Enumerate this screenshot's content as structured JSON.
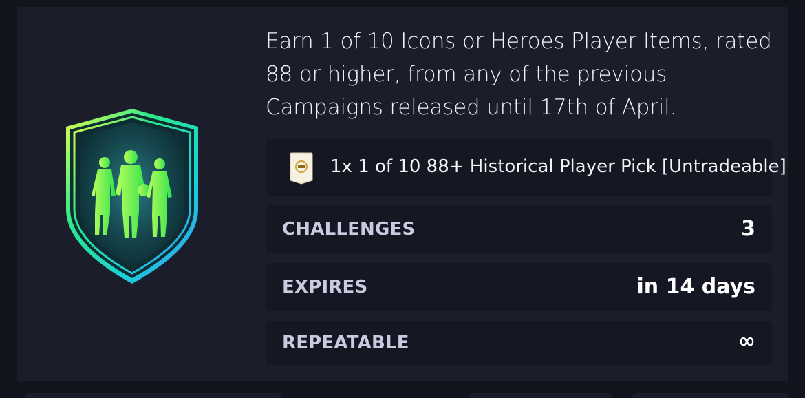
{
  "objective": {
    "description": "Earn 1 of 10 Icons or Heroes Player Items, rated 88 or higher, from any of the previous Campaigns released until 17th of April.",
    "badge_icon": "icons-heroes-shield-icon"
  },
  "reward": {
    "icon": "player-pick-pack-icon",
    "label": "1x 1 of 10 88+ Historical Player Pick [Untradeable]"
  },
  "stats": {
    "challenges": {
      "label": "CHALLENGES",
      "value": "3"
    },
    "expires": {
      "label": "EXPIRES",
      "value": "in 14 days"
    },
    "repeatable": {
      "label": "REPEATABLE",
      "value": "∞"
    }
  },
  "colors": {
    "background": "#11141c",
    "card": "#1b1e2a",
    "row": "#151822",
    "label": "#c9cbe0",
    "text": "#f3f4f7"
  }
}
